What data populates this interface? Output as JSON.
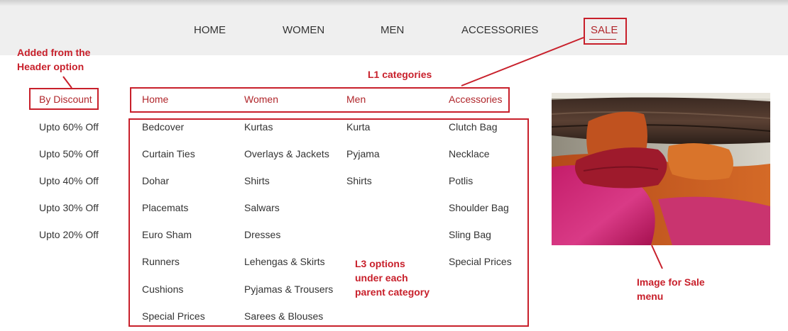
{
  "nav": {
    "items": [
      "HOME",
      "WOMEN",
      "MEN",
      "ACCESSORIES"
    ],
    "sale": "SALE"
  },
  "discount": {
    "title": "By Discount",
    "items": [
      "Upto 60% Off",
      "Upto 50% Off",
      "Upto 40% Off",
      "Upto 30% Off",
      "Upto 20% Off"
    ]
  },
  "l1": [
    "Home",
    "Women",
    "Men",
    "Accessories"
  ],
  "columns": [
    [
      "Bedcover",
      "Curtain Ties",
      "Dohar",
      "Placemats",
      "Euro Sham",
      "Runners",
      "Cushions",
      "Special Prices"
    ],
    [
      "Kurtas",
      "Overlays & Jackets",
      "Shirts",
      "Salwars",
      "Dresses",
      "Lehengas & Skirts",
      "Pyjamas & Trousers",
      "Sarees & Blouses"
    ],
    [
      "Kurta",
      "Pyjama",
      "Shirts"
    ],
    [
      "Clutch Bag",
      "Necklace",
      "Potlis",
      "Shoulder Bag",
      "Sling Bag",
      "Special Prices"
    ]
  ],
  "annotations": {
    "header_option_1": "Added from the",
    "header_option_2": "Header option",
    "l1_categories": "L1 categories",
    "l3_1": "L3 options",
    "l3_2": "under each",
    "l3_3": "parent category",
    "image_1": "Image for Sale",
    "image_2": "menu"
  },
  "colors": {
    "accent": "#b0262b",
    "annotation": "#c8202b",
    "nav_background": "#efefef",
    "text": "#333333"
  }
}
